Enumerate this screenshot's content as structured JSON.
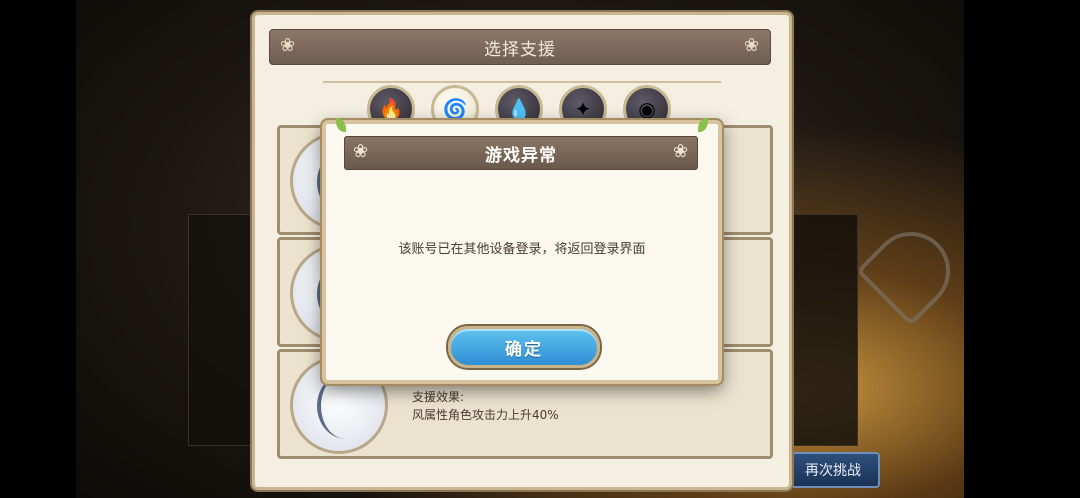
{
  "background": {
    "retry_button_label": "再次挑战"
  },
  "support_window": {
    "title": "选择支援",
    "elements": [
      {
        "name": "fire",
        "icon": "fire-icon",
        "glyph": "🔥",
        "active": false
      },
      {
        "name": "wind",
        "icon": "wind-icon",
        "glyph": "🌀",
        "active": true
      },
      {
        "name": "water",
        "icon": "water-icon",
        "glyph": "💧",
        "active": false
      },
      {
        "name": "light",
        "icon": "light-icon",
        "glyph": "✦",
        "active": false
      },
      {
        "name": "dark",
        "icon": "dark-icon",
        "glyph": "◉",
        "active": false
      }
    ],
    "effect_title": "支援效果:",
    "effect_text": "风属性角色攻击力上升40%"
  },
  "dialog": {
    "title": "游戏异常",
    "message": "该账号已在其他设备登录，将返回登录界面",
    "confirm_label": "确定"
  },
  "colors": {
    "confirm_button": "#2e8ed3",
    "dialog_header": "#7a6757",
    "dialog_bg": "#fbf8ef"
  }
}
